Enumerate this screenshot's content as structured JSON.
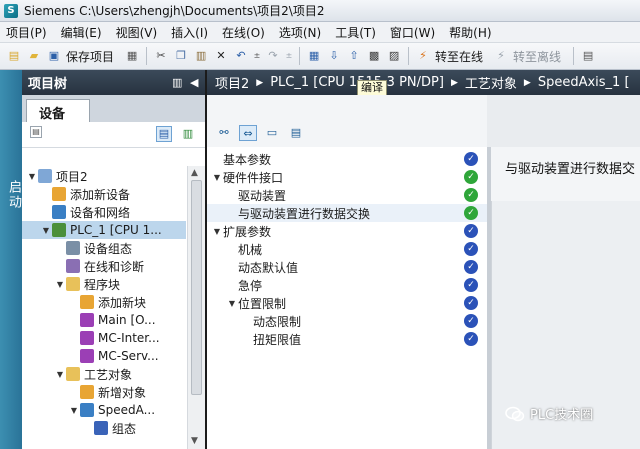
{
  "window": {
    "title": "Siemens    C:\\Users\\zhengjh\\Documents\\项目2\\项目2"
  },
  "menu": [
    "项目(P)",
    "编辑(E)",
    "视图(V)",
    "插入(I)",
    "在线(O)",
    "选项(N)",
    "工具(T)",
    "窗口(W)",
    "帮助(H)"
  ],
  "toolbar": {
    "save_label": "保存项目",
    "go_online_label": "转至在线",
    "go_offline_label": "转至离线",
    "tooltip": "编译"
  },
  "project_tree": {
    "header": "项目树",
    "tab_devices": "设备",
    "start_label": "启动",
    "items": [
      {
        "label": "项目2",
        "level": 0,
        "arrow": "▼",
        "icon": "project-icon",
        "color": "#7fa7d6"
      },
      {
        "label": "添加新设备",
        "level": 1,
        "arrow": "",
        "icon": "add-device-icon",
        "color": "#e8a534"
      },
      {
        "label": "设备和网络",
        "level": 1,
        "arrow": "",
        "icon": "network-icon",
        "color": "#3a7fc4"
      },
      {
        "label": "PLC_1 [CPU 1...",
        "level": 1,
        "arrow": "▼",
        "icon": "plc-icon",
        "color": "#4b8f3a",
        "selected": true
      },
      {
        "label": "设备组态",
        "level": 2,
        "arrow": "",
        "icon": "device-config-icon",
        "color": "#7a8fa6"
      },
      {
        "label": "在线和诊断",
        "level": 2,
        "arrow": "",
        "icon": "diagnostics-icon",
        "color": "#8a6fb3"
      },
      {
        "label": "程序块",
        "level": 2,
        "arrow": "▼",
        "icon": "folder-icon",
        "color": "#e8c15a"
      },
      {
        "label": "添加新块",
        "level": 3,
        "arrow": "",
        "icon": "add-block-icon",
        "color": "#e8a534"
      },
      {
        "label": "Main [O...",
        "level": 3,
        "arrow": "",
        "icon": "ob-icon",
        "color": "#9b3fb5"
      },
      {
        "label": "MC-Inter...",
        "level": 3,
        "arrow": "",
        "icon": "ob-icon",
        "color": "#9b3fb5"
      },
      {
        "label": "MC-Serv...",
        "level": 3,
        "arrow": "",
        "icon": "ob-icon",
        "color": "#9b3fb5"
      },
      {
        "label": "工艺对象",
        "level": 2,
        "arrow": "▼",
        "icon": "folder-icon",
        "color": "#e8c15a"
      },
      {
        "label": "新增对象",
        "level": 3,
        "arrow": "",
        "icon": "add-object-icon",
        "color": "#e8a534"
      },
      {
        "label": "SpeedA...",
        "level": 3,
        "arrow": "▼",
        "icon": "axis-icon",
        "color": "#3a7fc4"
      },
      {
        "label": "组态",
        "level": 4,
        "arrow": "",
        "icon": "config-icon",
        "color": "#3a63b8"
      }
    ]
  },
  "breadcrumb": [
    "项目2",
    "PLC_1 [CPU 1515-3 PN/DP]",
    "工艺对象",
    "SpeedAxis_1 ["
  ],
  "config_nav": {
    "items": [
      {
        "label": "基本参数",
        "level": 0,
        "arrow": "",
        "status": "cfg"
      },
      {
        "label": "硬件件接口",
        "level": 0,
        "arrow": "▼",
        "status": "ok"
      },
      {
        "label": "驱动装置",
        "level": 1,
        "arrow": "",
        "status": "ok"
      },
      {
        "label": "与驱动装置进行数据交换",
        "level": 1,
        "arrow": "",
        "status": "ok",
        "highlight": true
      },
      {
        "label": "扩展参数",
        "level": 0,
        "arrow": "▼",
        "status": "cfg"
      },
      {
        "label": "机械",
        "level": 1,
        "arrow": "",
        "status": "cfg"
      },
      {
        "label": "动态默认值",
        "level": 1,
        "arrow": "",
        "status": "cfg"
      },
      {
        "label": "急停",
        "level": 1,
        "arrow": "",
        "status": "cfg"
      },
      {
        "label": "位置限制",
        "level": 1,
        "arrow": "▼",
        "status": "cfg"
      },
      {
        "label": "动态限制",
        "level": 2,
        "arrow": "",
        "status": "cfg"
      },
      {
        "label": "扭矩限值",
        "level": 2,
        "arrow": "",
        "status": "cfg"
      }
    ]
  },
  "detail": {
    "title": "与驱动装置进行数据交"
  },
  "watermark": "PLC技术圈"
}
